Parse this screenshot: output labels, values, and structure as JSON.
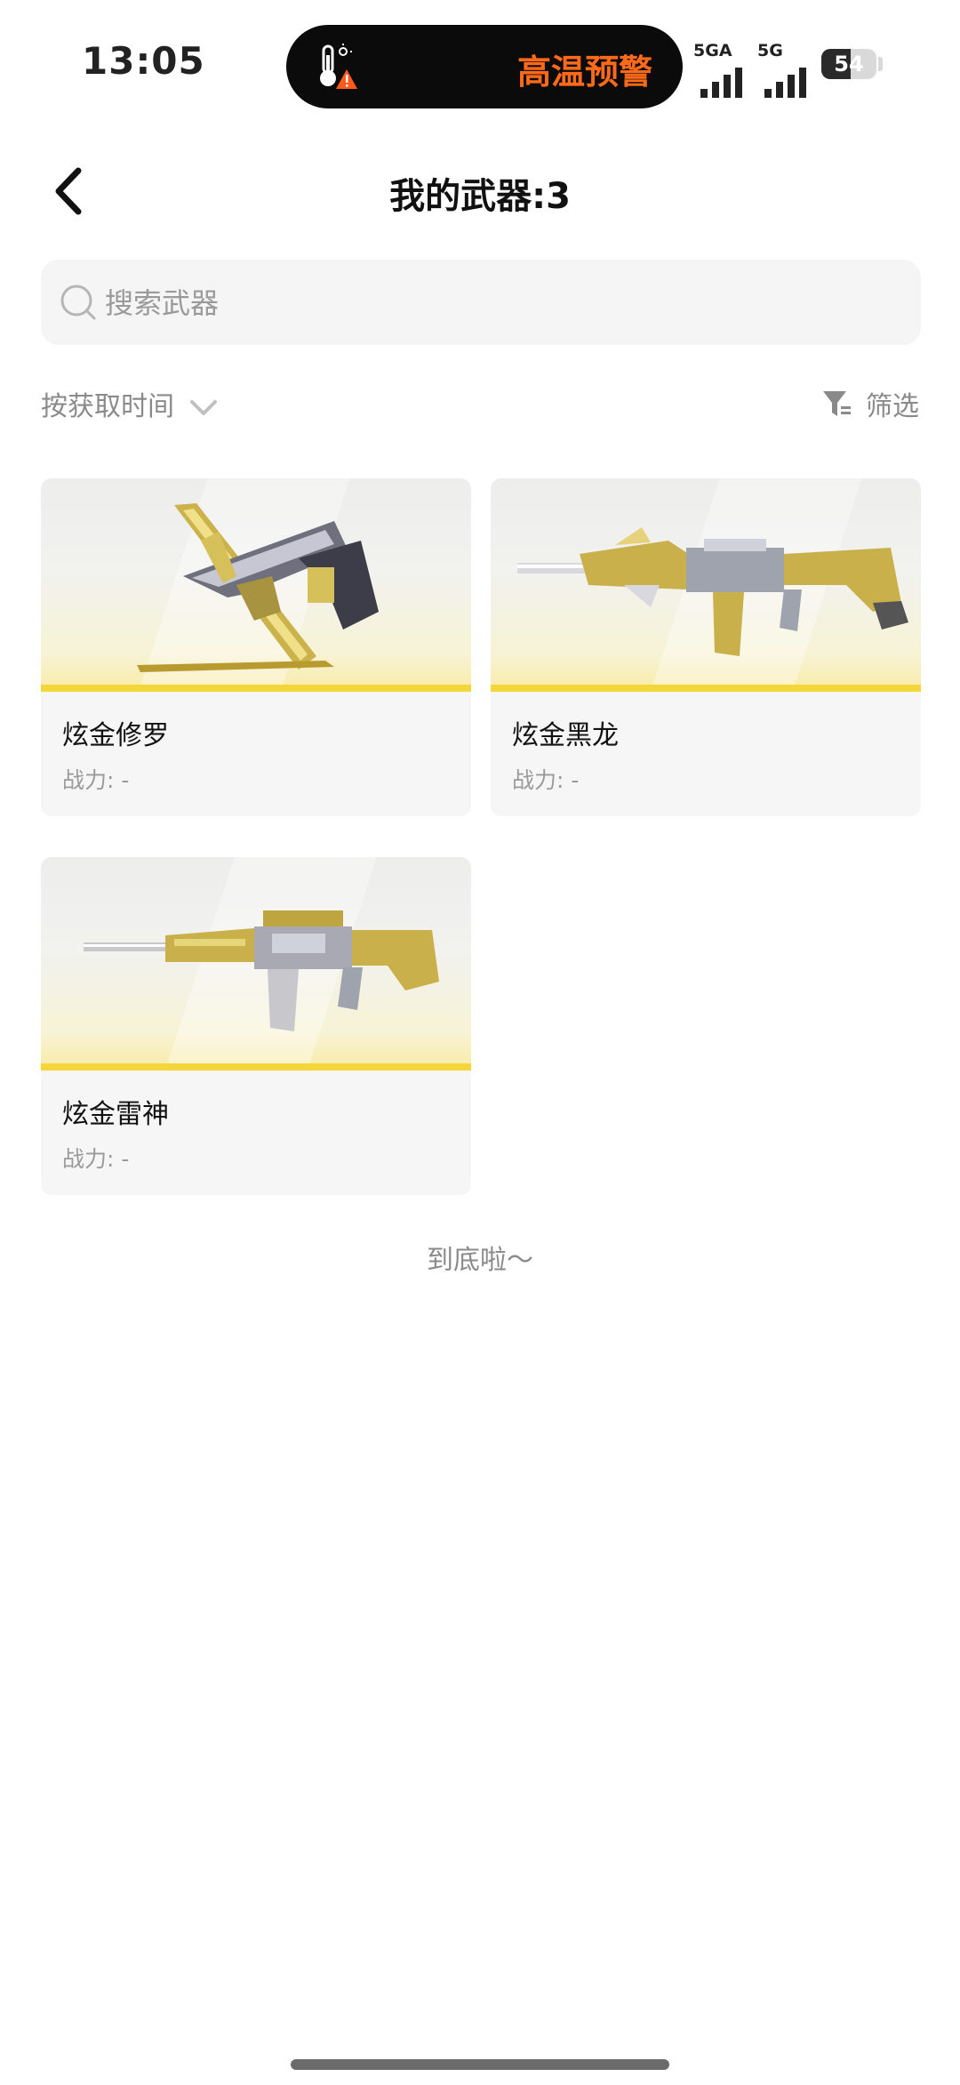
{
  "status_bar": {
    "time": "13:05",
    "alert_text": "高温预警",
    "alert_icon": "thermometer-warning-icon",
    "signal1_label": "5GA",
    "signal2_label": "5G",
    "battery": "54",
    "battery_level": 0.54,
    "alert_color": "#ff6a1a"
  },
  "header": {
    "back_icon": "chevron-left-icon",
    "title": "我的武器:3"
  },
  "search": {
    "icon": "search-icon",
    "placeholder": "搜索武器",
    "value": ""
  },
  "toolbar": {
    "sort_label": "按获取时间",
    "sort_icon": "chevron-down-icon",
    "filter_label": "筛选",
    "filter_icon": "funnel-icon"
  },
  "weapons": [
    {
      "name": "炫金修罗",
      "power": "战力: -",
      "image": "golden-pistol-with-blades"
    },
    {
      "name": "炫金黑龙",
      "power": "战力: -",
      "image": "golden-dragon-rifle"
    },
    {
      "name": "炫金雷神",
      "power": "战力: -",
      "image": "golden-assault-rifle"
    }
  ],
  "footer": {
    "end_text": "到底啦～"
  },
  "colors": {
    "accent_yellow": "#f5d63a",
    "card_bg": "#f6f6f6",
    "search_bg": "#f5f5f5"
  }
}
